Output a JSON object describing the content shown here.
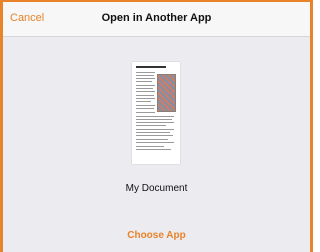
{
  "navbar": {
    "cancel_label": "Cancel",
    "title": "Open in Another App"
  },
  "document": {
    "name": "My Document"
  },
  "actions": {
    "choose_app_label": "Choose App"
  },
  "colors": {
    "accent": "#e8832a",
    "background": "#ececf0",
    "navbar_background": "#f7f7f7"
  }
}
